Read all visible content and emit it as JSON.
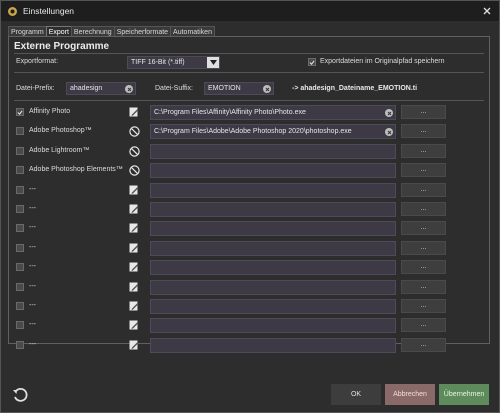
{
  "window": {
    "title": "Einstellungen"
  },
  "tabs": [
    {
      "label": "Programm"
    },
    {
      "label": "Export"
    },
    {
      "label": "Berechnung"
    },
    {
      "label": "Speicherformate"
    },
    {
      "label": "Automatiken"
    }
  ],
  "section": {
    "title": "Externe Programme"
  },
  "export_format": {
    "label": "Exportformat:",
    "value": "TIFF 16-Bit (*.tiff)"
  },
  "save_original": {
    "label": "Exportdateien im Originalpfad speichern",
    "checked": true
  },
  "prefix": {
    "label": "Datei-Prefix:",
    "value": "ahadesign"
  },
  "suffix": {
    "label": "Datei-Suffix:",
    "value": "EMOTION"
  },
  "preview": {
    "text": "-> ahadesign_Dateiname_EMOTION.ti"
  },
  "programs": [
    {
      "name": "Affinity Photo",
      "checked": true,
      "icon": "edit-icon",
      "path": "C:\\Program Files\\Affinity\\Affinity Photo\\Photo.exe",
      "browse": "..."
    },
    {
      "name": "Adobe Photoshop™",
      "checked": false,
      "icon": "no-entry-icon",
      "path": "C:\\Program Files\\Adobe\\Adobe Photoshop 2020\\photoshop.exe",
      "browse": "..."
    },
    {
      "name": "Adobe Lightroom™",
      "checked": false,
      "icon": "no-entry-icon",
      "path": "",
      "browse": "..."
    },
    {
      "name": "Adobe Photoshop Elements™",
      "checked": false,
      "icon": "no-entry-icon",
      "path": "",
      "browse": "..."
    },
    {
      "name": "---",
      "checked": false,
      "icon": "edit-icon",
      "path": "",
      "browse": "..."
    },
    {
      "name": "---",
      "checked": false,
      "icon": "edit-icon",
      "path": "",
      "browse": "..."
    },
    {
      "name": "---",
      "checked": false,
      "icon": "edit-icon",
      "path": "",
      "browse": "..."
    },
    {
      "name": "---",
      "checked": false,
      "icon": "edit-icon",
      "path": "",
      "browse": "..."
    },
    {
      "name": "---",
      "checked": false,
      "icon": "edit-icon",
      "path": "",
      "browse": "..."
    },
    {
      "name": "---",
      "checked": false,
      "icon": "edit-icon",
      "path": "",
      "browse": "..."
    },
    {
      "name": "---",
      "checked": false,
      "icon": "edit-icon",
      "path": "",
      "browse": "..."
    },
    {
      "name": "---",
      "checked": false,
      "icon": "edit-icon",
      "path": "",
      "browse": "..."
    },
    {
      "name": "---",
      "checked": false,
      "icon": "edit-icon",
      "path": "",
      "browse": "..."
    }
  ],
  "buttons": {
    "ok": "OK",
    "cancel": "Abbrechen",
    "apply": "Übernehmen"
  },
  "colors": {
    "cancel_bg": "#8a6a69",
    "apply_bg": "#5e8b5b",
    "ok_bg": "#3d3d3d",
    "field_bg": "#3d3a45"
  }
}
